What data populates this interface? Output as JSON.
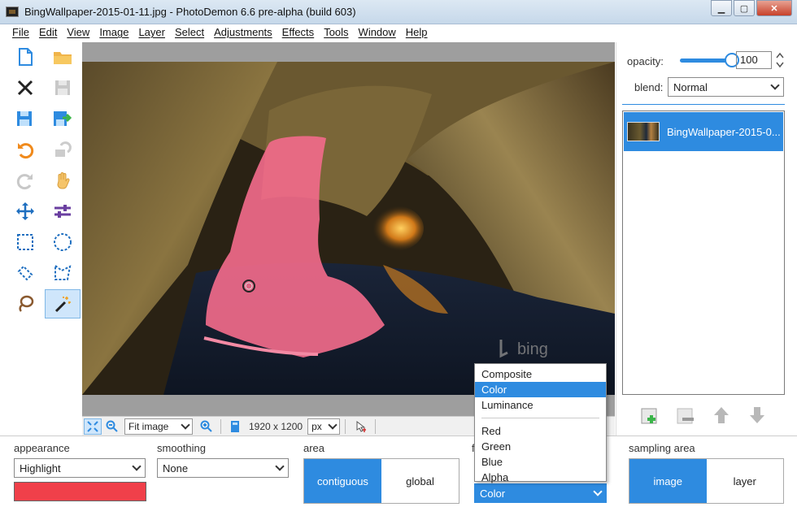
{
  "window": {
    "title": "BingWallpaper-2015-01-11.jpg  -  PhotoDemon 6.6 pre-alpha (build 603)"
  },
  "menu": [
    "File",
    "Edit",
    "View",
    "Image",
    "Layer",
    "Select",
    "Adjustments",
    "Effects",
    "Tools",
    "Window",
    "Help"
  ],
  "toolbox": {
    "tools": [
      "new-file",
      "open-folder",
      "close",
      "save",
      "save-as",
      "export",
      "undo",
      "redo-history",
      "redo",
      "hand",
      "move",
      "adjust-sliders",
      "rect-select",
      "ellipse-select",
      "line-select",
      "polygon-select",
      "lasso-select",
      "magic-wand"
    ]
  },
  "canvas": {
    "watermark": "bing",
    "zoom_value": "Fit image",
    "image_size": "1920 x 1200",
    "unit": "px"
  },
  "layers_panel": {
    "opacity_label": "opacity:",
    "opacity_value": "100",
    "opacity_fraction": 1.0,
    "blend_label": "blend:",
    "blend_value": "Normal",
    "layers": [
      {
        "name": "BingWallpaper-2015-0..."
      }
    ]
  },
  "options": {
    "appearance_label": "appearance",
    "appearance_value": "Highlight",
    "highlight_color": "#f0404a",
    "smoothing_label": "smoothing",
    "smoothing_value": "None",
    "area_label": "area",
    "area_on": "contiguous",
    "area_off": "global",
    "compare_label": "f",
    "compare_value": "Color",
    "sampling_label": "sampling area",
    "sampling_on": "image",
    "sampling_off": "layer"
  },
  "compare_popup": {
    "items_top": [
      "Composite",
      "Color",
      "Luminance"
    ],
    "items_bottom": [
      "Red",
      "Green",
      "Blue",
      "Alpha"
    ],
    "selected": "Color"
  },
  "colors": {
    "accent": "#2e8be0",
    "selection_overlay": "#f06a8a"
  }
}
